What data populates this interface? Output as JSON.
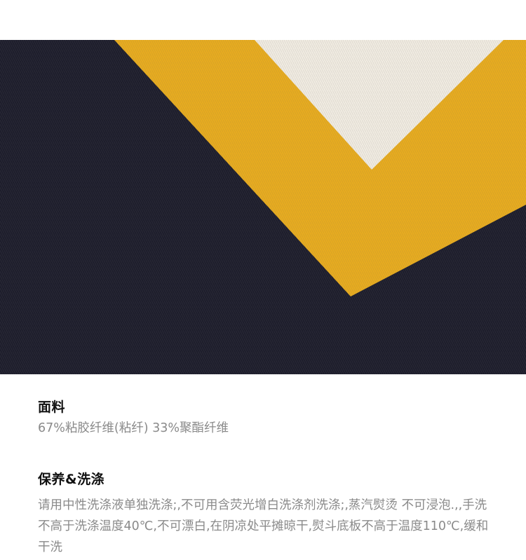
{
  "product_image": {
    "description_name": "knit-sweater-closeup",
    "colors": {
      "navy": "#1d1d2b",
      "yellow": "#e8ac1f",
      "cream": "#f1ece2"
    }
  },
  "fabric": {
    "title": "面料",
    "content": "67%粘胶纤维(粘纤) 33%聚酯纤维"
  },
  "care": {
    "title": "保养&洗涤",
    "content": "请用中性洗涤液单独洗涤;,不可用含荧光增白洗涤剂洗涤;,蒸汽熨烫 不可浸泡.,,手洗不高于洗涤温度40℃,不可漂白,在阴凉处平摊晾干,熨斗底板不高于温度110℃,缓和干洗"
  }
}
